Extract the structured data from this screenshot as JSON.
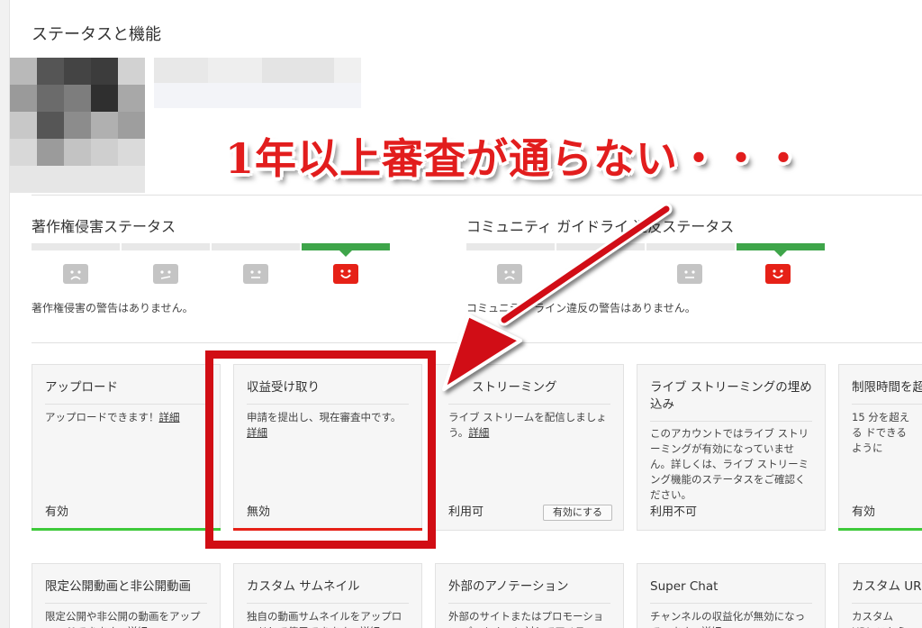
{
  "page": {
    "title": "ステータスと機能"
  },
  "annotation": {
    "banner_text": "1年以上審査が通らない・・・",
    "color": "#d10d14"
  },
  "copyright": {
    "title": "著作権侵害ステータス",
    "message": "著作権侵害の警告はありません。",
    "level_active_index": 3,
    "faces": [
      "sad-face-icon",
      "frown-face-icon",
      "neutral-face-icon",
      "smile-face-icon"
    ]
  },
  "community": {
    "title": "コミュニティ ガイドライ  違反ステータス",
    "message": "コミュニティ     ライン違反の警告はありません。",
    "level_active_index": 3,
    "faces": [
      "sad-face-icon",
      "frown-face-icon",
      "neutral-face-icon",
      "smile-face-icon"
    ]
  },
  "cards": [
    {
      "title": "アップロード",
      "desc": "アップロードできます！",
      "link": "詳細",
      "status": "有効",
      "bar": "green"
    },
    {
      "title": "収益受け取り",
      "desc": "申請を提出し、現在審査中です。",
      "link": "詳細",
      "status": "無効",
      "bar": "red"
    },
    {
      "title": "ストリーミング",
      "desc": "ライブ ストリームを配信しましょう。",
      "link": "詳細",
      "status": "利用可",
      "button": "有効にする",
      "bar": ""
    },
    {
      "title": "ライブ ストリーミングの埋め込み",
      "desc": "このアカウントではライブ ストリーミングが有効になっていません。詳しくは、ライブ ストリーミング機能のステータスをご確認ください。",
      "link": "",
      "status": "利用不可",
      "bar": ""
    },
    {
      "title": "制限時間を超",
      "desc": "15 分を超える ドできるように",
      "link": "",
      "status": "有効",
      "bar": "green"
    }
  ],
  "cards_row2": [
    {
      "title": "限定公開動画と非公開動画",
      "desc": "限定公開や非公開の動画をアップロードできます。",
      "link": "詳細"
    },
    {
      "title": "カスタム サムネイル",
      "desc": "独自の動画サムネイルをアップロードして使用できます。",
      "link": "詳細"
    },
    {
      "title": "外部のアノテーション",
      "desc": "外部のサイトまたはプロモーション パートナーに対してアノテー",
      "link": ""
    },
    {
      "title": "Super Chat",
      "desc": "チャンネルの収益化が無効になっています。",
      "link": "詳細"
    },
    {
      "title": "カスタム URL",
      "desc": "カスタム URL こちらで作成",
      "link": ""
    }
  ]
}
